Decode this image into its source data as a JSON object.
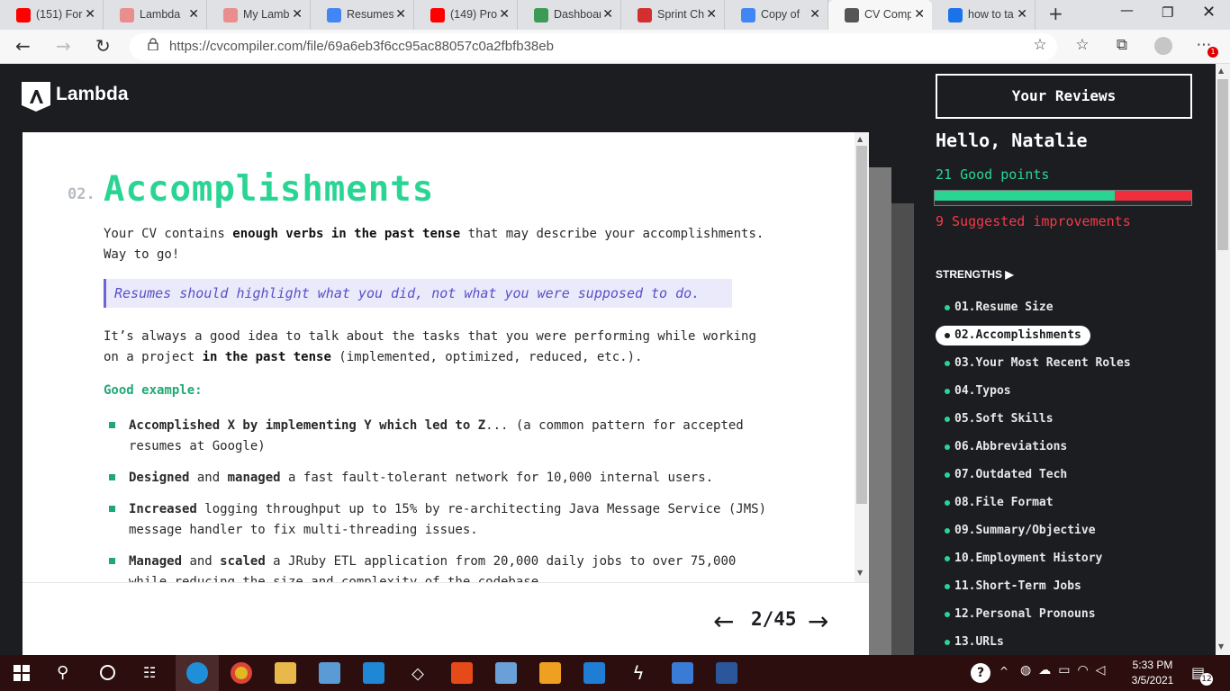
{
  "browser": {
    "tabs": [
      {
        "label": "(151) For",
        "color": "#ff0000"
      },
      {
        "label": "Lambda",
        "color": "#e98d8d"
      },
      {
        "label": "My Lamb",
        "color": "#e98d8d"
      },
      {
        "label": "Resumes",
        "color": "#4285f4"
      },
      {
        "label": "(149) Pro",
        "color": "#ff0000"
      },
      {
        "label": "Dashboar",
        "color": "#3c9a54"
      },
      {
        "label": "Sprint Ch",
        "color": "#d32f2f"
      },
      {
        "label": "Copy of",
        "color": "#4285f4"
      },
      {
        "label": "CV Comp",
        "color": "#555555"
      },
      {
        "label": "how to ta",
        "color": "#1a73e8"
      }
    ],
    "url": "https://cvcompiler.com/file/69a6eb3f6cc95ac88057c0a2fbfb38eb",
    "notification_badge": "1"
  },
  "brand": "Lambda",
  "section": {
    "number": "02.",
    "title": "Accomplishments",
    "intro_1": "Your CV contains ",
    "intro_bold": "enough verbs in the past tense",
    "intro_2": " that may describe your accomplishments.",
    "intro_3": "Way to go!",
    "quote": "Resumes should highlight what you did, not what you were supposed to do.",
    "para2_1": "It’s always a good idea to talk about the tasks that you were performing while working",
    "para2_2": "on a project ",
    "para2_bold": "in the past tense",
    "para2_3": " (implemented, optimized, reduced, etc.).",
    "good_label": "Good example:",
    "bullets": [
      {
        "b1": "Accomplished X by implementing Y which led to Z",
        "t1": "... (a common pattern for accepted",
        "t2": "resumes at Google)"
      },
      {
        "b1": "Designed",
        "t1": " and ",
        "b2": "managed",
        "t2": " a fast fault-tolerant network for 10,000 internal users."
      },
      {
        "b1": "Increased",
        "t1": " logging throughput up to 15% by re-architecting Java Message Service (JMS)",
        "t2": "message handler to fix multi-threading issues."
      },
      {
        "b1": "Managed",
        "t1": " and ",
        "b2": "scaled",
        "t2": " a JRuby ETL application from 20,000 daily jobs to over 75,000",
        "t3": "while reducing the size and complexity of the codebase."
      }
    ]
  },
  "pager": {
    "text": "2/45",
    "prev": "←",
    "next": "→"
  },
  "sidebar": {
    "reviews_button": "Your Reviews",
    "greeting": "Hello, Natalie",
    "good_points": "21 Good points",
    "improvements": "9 Suggested improvements",
    "good_count": 21,
    "improve_count": 9,
    "good_color": "#2ad594",
    "bad_color": "#f02e3d",
    "strengths_label": "STRENGTHS ▶",
    "items": [
      "01.Resume Size",
      "02.Accomplishments",
      "03.Your Most Recent Roles",
      "04.Typos",
      "05.Soft Skills",
      "06.Abbreviations",
      "07.Outdated Tech",
      "08.File Format",
      "09.Summary/Objective",
      "10.Employment History",
      "11.Short-Term Jobs",
      "12.Personal Pronouns",
      "13.URLs"
    ],
    "active_item": 1
  },
  "taskbar": {
    "time": "5:33 PM",
    "date": "3/5/2021",
    "notifications": "12"
  }
}
